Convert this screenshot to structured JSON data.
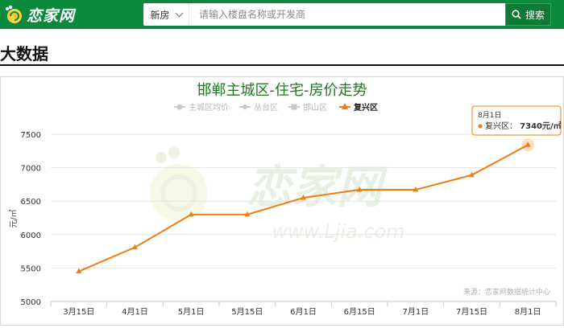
{
  "header": {
    "logo_text": "恋家网",
    "search_type": "新房",
    "search_placeholder": "请输入楼盘名称或开发商",
    "search_button": "搜索"
  },
  "section": {
    "title": "大数据"
  },
  "watermark": {
    "brand": "恋家网",
    "url": "www.Ljia.com"
  },
  "chart_data": {
    "type": "line",
    "title": "邯郸主城区-住宅-房价走势",
    "ylabel": "元/㎡",
    "ylim": [
      5000,
      7500
    ],
    "yticks": [
      5000,
      5500,
      6000,
      6500,
      7000,
      7500
    ],
    "categories": [
      "3月15日",
      "4月1日",
      "5月1日",
      "5月15日",
      "6月1日",
      "6月15日",
      "7月1日",
      "7月15日",
      "8月1日"
    ],
    "legend": [
      "主城区均价",
      "丛台区",
      "邯山区",
      "复兴区"
    ],
    "legend_position": "top",
    "series": [
      {
        "name": "复兴区",
        "color": "#f07d12",
        "values": [
          5450,
          5810,
          6300,
          6300,
          6550,
          6670,
          6670,
          6890,
          7340
        ]
      }
    ],
    "grid": true,
    "tooltip": {
      "date": "8月1日",
      "series": "复兴区",
      "value_text": "7340元/㎡"
    },
    "source": "来源：恋家网数据统计中心"
  }
}
